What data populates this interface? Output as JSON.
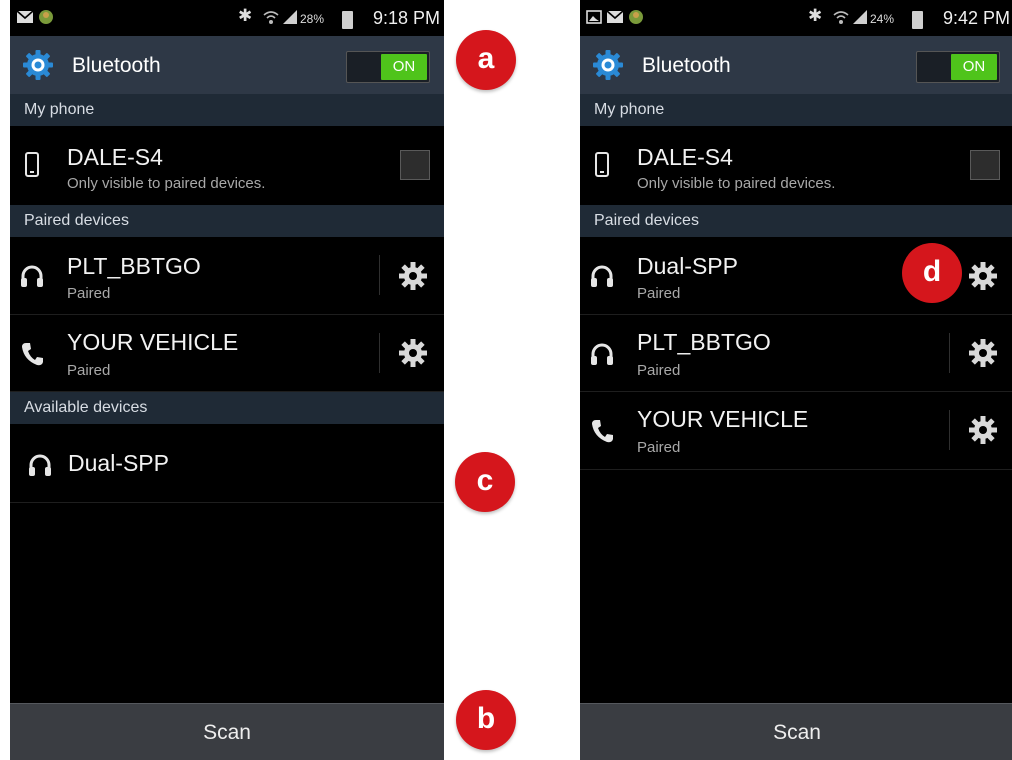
{
  "left": {
    "status": {
      "battery": "28%",
      "time": "9:18 PM"
    },
    "header": {
      "title": "Bluetooth",
      "toggle": "ON"
    },
    "my_phone_section": "My phone",
    "my_phone": {
      "name": "DALE-S4",
      "sub": "Only visible to paired devices."
    },
    "paired_section": "Paired devices",
    "paired": [
      {
        "name": "PLT_BBTGO",
        "sub": "Paired",
        "icon": "headphones-icon"
      },
      {
        "name": "YOUR VEHICLE",
        "sub": "Paired",
        "icon": "phone-handset-icon"
      }
    ],
    "available_section": "Available devices",
    "available": [
      {
        "name": "Dual-SPP",
        "icon": "headphones-icon"
      }
    ],
    "scan": "Scan"
  },
  "right": {
    "status": {
      "battery": "24%",
      "time": "9:42 PM"
    },
    "header": {
      "title": "Bluetooth",
      "toggle": "ON"
    },
    "my_phone_section": "My phone",
    "my_phone": {
      "name": "DALE-S4",
      "sub": "Only visible to paired devices."
    },
    "paired_section": "Paired devices",
    "paired": [
      {
        "name": "Dual-SPP",
        "sub": "Paired",
        "icon": "headphones-icon"
      },
      {
        "name": "PLT_BBTGO",
        "sub": "Paired",
        "icon": "headphones-icon"
      },
      {
        "name": "YOUR VEHICLE",
        "sub": "Paired",
        "icon": "phone-handset-icon"
      }
    ],
    "scan": "Scan"
  },
  "callouts": {
    "a": "a",
    "b": "b",
    "c": "c",
    "d": "d"
  },
  "colors": {
    "header": "#2e3846",
    "section": "#1f2a36",
    "toggle_on": "#4fc41b",
    "callout": "#d5161c",
    "scan_bar": "#3a3d42"
  }
}
